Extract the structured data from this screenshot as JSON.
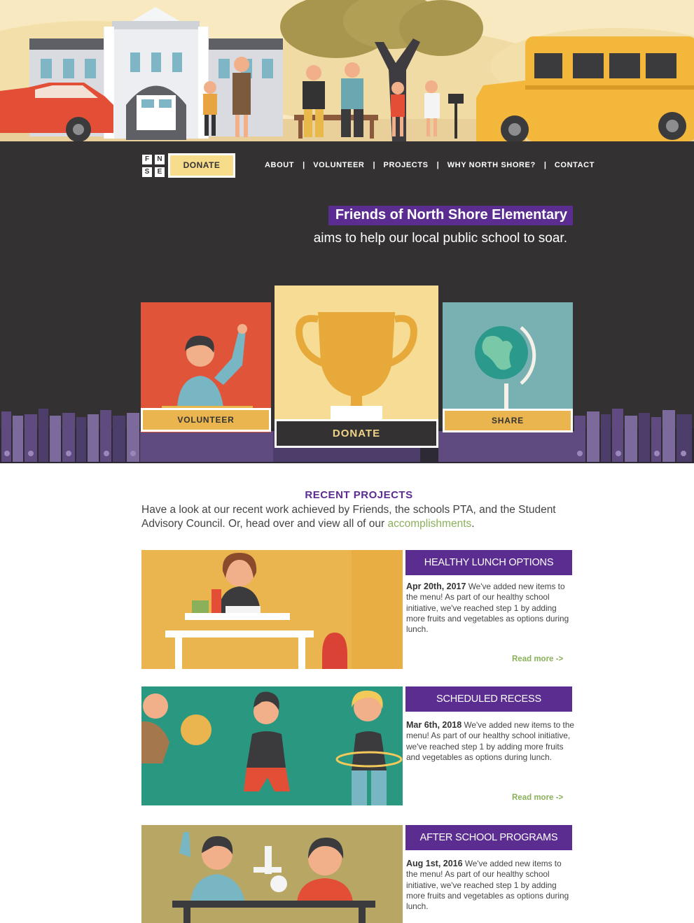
{
  "nav": {
    "logo_letters": [
      "F",
      "N",
      "S",
      "E"
    ],
    "donate_label": "DONATE",
    "items": [
      {
        "label": "ABOUT"
      },
      {
        "label": "VOLUNTEER"
      },
      {
        "label": "PROJECTS"
      },
      {
        "label": "WHY NORTH SHORE?"
      },
      {
        "label": "CONTACT"
      }
    ],
    "separator": "|"
  },
  "hero": {
    "title": "Friends of North Shore Elementary",
    "subtitle": "aims to help our local public school to soar."
  },
  "cards": {
    "volunteer_label": "VOLUNTEER",
    "donate_label": "DONATE",
    "share_label": "SHARE"
  },
  "recent": {
    "title": "RECENT PROJECTS",
    "intro_1": "Have a look  at our recent work achieved by Friends, the schools PTA, and the Student Advisory Council. Or, head over and view all of our ",
    "intro_link": "accomplishments",
    "intro_2": ".",
    "projects": [
      {
        "title": "HEALTHY LUNCH OPTIONS",
        "date": "Apr 20th, 2017",
        "text": " We've added new items to the menu! As part of our healthy school initiative, we've reached step 1 by adding more fruits and vegetables as options during lunch.",
        "more": "Read more ->"
      },
      {
        "title": "SCHEDULED RECESS",
        "date": "Mar 6th, 2018",
        "text": " We've added new items to the menu! As part of our healthy school initiative, we've reached step 1 by adding more fruits and vegetables as options during lunch.",
        "more": "Read more ->"
      },
      {
        "title": "AFTER SCHOOL PROGRAMS",
        "date": "Aug 1st, 2016",
        "text": " We've added new items to the menu! As part of our healthy school initiative, we've reached step 1 by adding more fruits and vegetables as options during lunch."
      }
    ]
  },
  "colors": {
    "purple": "#5b2d91",
    "dark": "#333132",
    "yellow": "#eab54e",
    "green_link": "#8ab05a"
  }
}
